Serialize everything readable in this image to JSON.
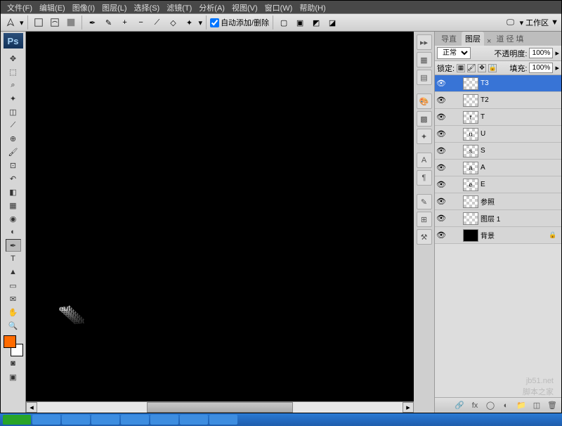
{
  "menu": {
    "file": "文件(F)",
    "edit": "编辑(E)",
    "image": "图像(I)",
    "layer": "图层(L)",
    "select": "选择(S)",
    "filter": "滤镜(T)",
    "analysis": "分析(A)",
    "view": "视图(V)",
    "window": "窗口(W)",
    "help": "帮助(H)"
  },
  "options": {
    "auto_add_delete": "自动添加/删除",
    "workspace": "工作区",
    "workspace_arrow": "▼"
  },
  "canvas": {
    "text3d": "tuse"
  },
  "dock": {
    "expand": "▸▸"
  },
  "layers_tabs": {
    "t1": "导直",
    "t2": "图层",
    "t3": "道 径 填",
    "close": "×"
  },
  "layers_panel": {
    "mode": "正常",
    "opacity_label": "不透明度:",
    "opacity": "100%",
    "lock_label": "锁定:",
    "fill_label": "填充:",
    "fill": "100%"
  },
  "layers": [
    {
      "vis": "👁",
      "name": "T3",
      "letter": "",
      "sel": true
    },
    {
      "vis": "👁",
      "name": "T2",
      "letter": ""
    },
    {
      "vis": "👁",
      "name": "T",
      "letter": "t"
    },
    {
      "vis": "👁",
      "name": "U",
      "letter": "u"
    },
    {
      "vis": "👁",
      "name": "S",
      "letter": "s"
    },
    {
      "vis": "👁",
      "name": "A",
      "letter": "a"
    },
    {
      "vis": "👁",
      "name": "E",
      "letter": "e"
    },
    {
      "vis": "👁",
      "name": "参照",
      "letter": ""
    },
    {
      "vis": "👁",
      "name": "图层 1",
      "letter": ""
    },
    {
      "vis": "👁",
      "name": "背景",
      "letter": "",
      "lock": "🔒",
      "dark": true
    }
  ],
  "watermark": {
    "l1": "jb51.net",
    "l2": "脚本之家"
  }
}
